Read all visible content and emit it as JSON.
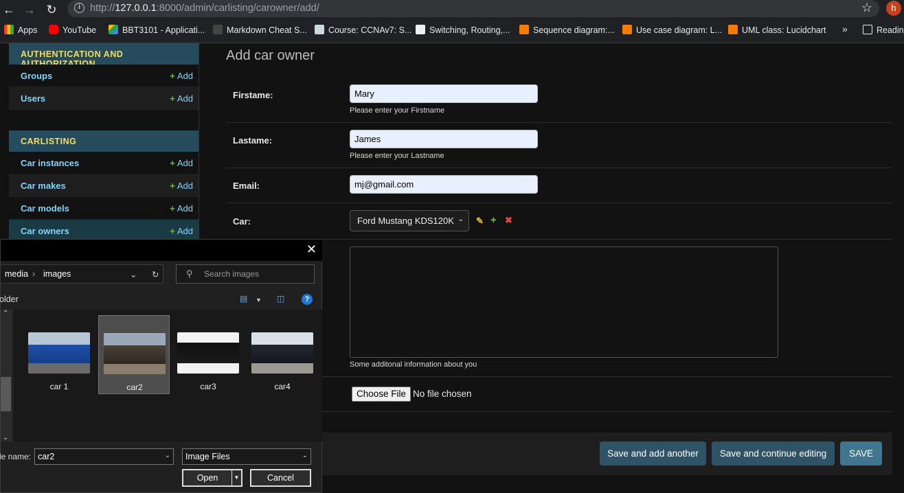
{
  "browser": {
    "url_prefix": "http://",
    "url_host": "127.0.0.1",
    "url_rest": ":8000/admin/carlisting/carowner/add/",
    "profile_initial": "h",
    "bookmarks": [
      {
        "label": "Apps",
        "color": "#ea4335"
      },
      {
        "label": "YouTube",
        "color": "#ff0000"
      },
      {
        "label": "BBT3101 - Applicati...",
        "color": "#1fa463"
      },
      {
        "label": "Markdown Cheat S...",
        "color": "#333333"
      },
      {
        "label": "Course: CCNAv7: S...",
        "color": "#cfd8dc"
      },
      {
        "label": "Switching, Routing,...",
        "color": "#eceff1"
      },
      {
        "label": "Sequence diagram:...",
        "color": "#f57c00"
      },
      {
        "label": "Use case diagram: L...",
        "color": "#f57c00"
      },
      {
        "label": "UML class: Lucidchart",
        "color": "#f57c00"
      }
    ],
    "overflow": "»",
    "reading_list": "Readin"
  },
  "sidebar": {
    "auth_caption": "AUTHENTICATION AND AUTHORIZATION",
    "auth_items": [
      {
        "name": "Groups",
        "add": "Add"
      },
      {
        "name": "Users",
        "add": "Add"
      }
    ],
    "app_caption": "CARLISTING",
    "app_items": [
      {
        "name": "Car instances",
        "add": "Add"
      },
      {
        "name": "Car makes",
        "add": "Add"
      },
      {
        "name": "Car models",
        "add": "Add"
      },
      {
        "name": "Car owners",
        "add": "Add"
      }
    ]
  },
  "form": {
    "title": "Add car owner",
    "firstname_label": "Firstame:",
    "firstname_value": "Mary",
    "firstname_help": "Please enter your Firstname",
    "lastname_label": "Lastame:",
    "lastname_value": "James",
    "lastname_help": "Please enter your Lastname",
    "email_label": "Email:",
    "email_value": "mj@gmail.com",
    "car_label": "Car:",
    "car_value": "Ford Mustang KDS120K",
    "about_help": "Some additonal information about you",
    "choose_file": "Choose File",
    "no_file": "No file chosen",
    "save_add_another": "Save and add another",
    "save_continue": "Save and continue editing",
    "save": "SAVE"
  },
  "dialog": {
    "path": [
      "media",
      "images"
    ],
    "search_placeholder": "Search images",
    "folder_label": "older",
    "files": [
      {
        "name": "car 1",
        "color": "#1e4fa8"
      },
      {
        "name": "car2",
        "color": "#4a4036"
      },
      {
        "name": "car3",
        "color": "#111111"
      },
      {
        "name": "car4",
        "color": "#222630"
      }
    ],
    "file_name_label": "le name:",
    "file_name_value": "car2",
    "file_type": "Image Files",
    "open": "Open",
    "cancel": "Cancel"
  }
}
